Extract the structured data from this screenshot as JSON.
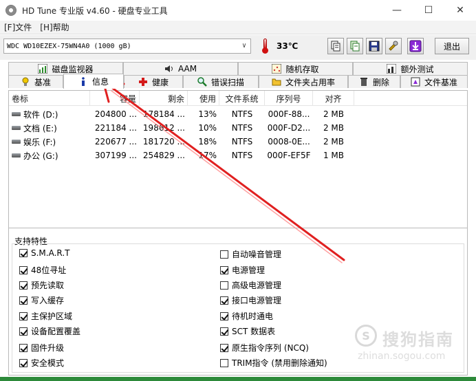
{
  "window": {
    "title": "HD Tune 专业版 v4.60 - 硬盘专业工具",
    "minimize": "—",
    "maximize": "☐",
    "close": "✕"
  },
  "menu": {
    "items": [
      "[F]文件",
      "[H]帮助"
    ]
  },
  "toolbar": {
    "drive": "WDC WD10EZEX-75WN4A0 (1000 gB)",
    "temperature": "33℃",
    "exit_label": "退出"
  },
  "tabs": {
    "row1": [
      "磁盘监视器",
      "AAM",
      "随机存取",
      "额外测试"
    ],
    "row2": [
      "基准",
      "信息",
      "健康",
      "错误扫描",
      "文件夹占用率",
      "删除",
      "文件基准"
    ],
    "active": "信息"
  },
  "volumes": {
    "columns": [
      "卷标",
      "容量",
      "剩余",
      "使用",
      "文件系统",
      "序列号",
      "对齐"
    ],
    "rows": [
      [
        "软件 (D:)",
        "204800 ...",
        "178184 ...",
        "13%",
        "NTFS",
        "000F-88...",
        "2 MB"
      ],
      [
        "文档 (E:)",
        "221184 ...",
        "198612 ...",
        "10%",
        "NTFS",
        "000F-D2...",
        "2 MB"
      ],
      [
        "娱乐 (F:)",
        "220677 ...",
        "181720 ...",
        "18%",
        "NTFS",
        "0008-0E...",
        "2 MB"
      ],
      [
        "办公 (G:)",
        "307199 ...",
        "254829 ...",
        "17%",
        "NTFS",
        "000F-EF5F",
        "1 MB"
      ]
    ]
  },
  "features": {
    "title": "支持特性",
    "left": [
      {
        "label": "S.M.A.R.T",
        "checked": true
      },
      {
        "label": "48位寻址",
        "checked": true
      },
      {
        "label": "预先读取",
        "checked": true
      },
      {
        "label": "写入缓存",
        "checked": true
      },
      {
        "label": "主保护区域",
        "checked": true
      },
      {
        "label": "设备配置覆盖",
        "checked": true
      },
      {
        "label": "固件升级",
        "checked": true
      },
      {
        "label": "安全模式",
        "checked": true
      }
    ],
    "right": [
      {
        "label": "自动噪音管理",
        "checked": false
      },
      {
        "label": "电源管理",
        "checked": true
      },
      {
        "label": "高级电源管理",
        "checked": false
      },
      {
        "label": "接口电源管理",
        "checked": true
      },
      {
        "label": "待机时通电",
        "checked": true
      },
      {
        "label": "SCT 数据表",
        "checked": true
      },
      {
        "label": "原生指令序列 (NCQ)",
        "checked": true
      },
      {
        "label": "TRIM指令 (禁用删除通知)",
        "checked": false
      }
    ]
  },
  "watermark": {
    "logo": "S",
    "text": "搜狗指南",
    "url": "zhinan.sogou.com"
  },
  "colors": {
    "arrow": "#e02020",
    "accent_green": "#2d8a3a"
  }
}
